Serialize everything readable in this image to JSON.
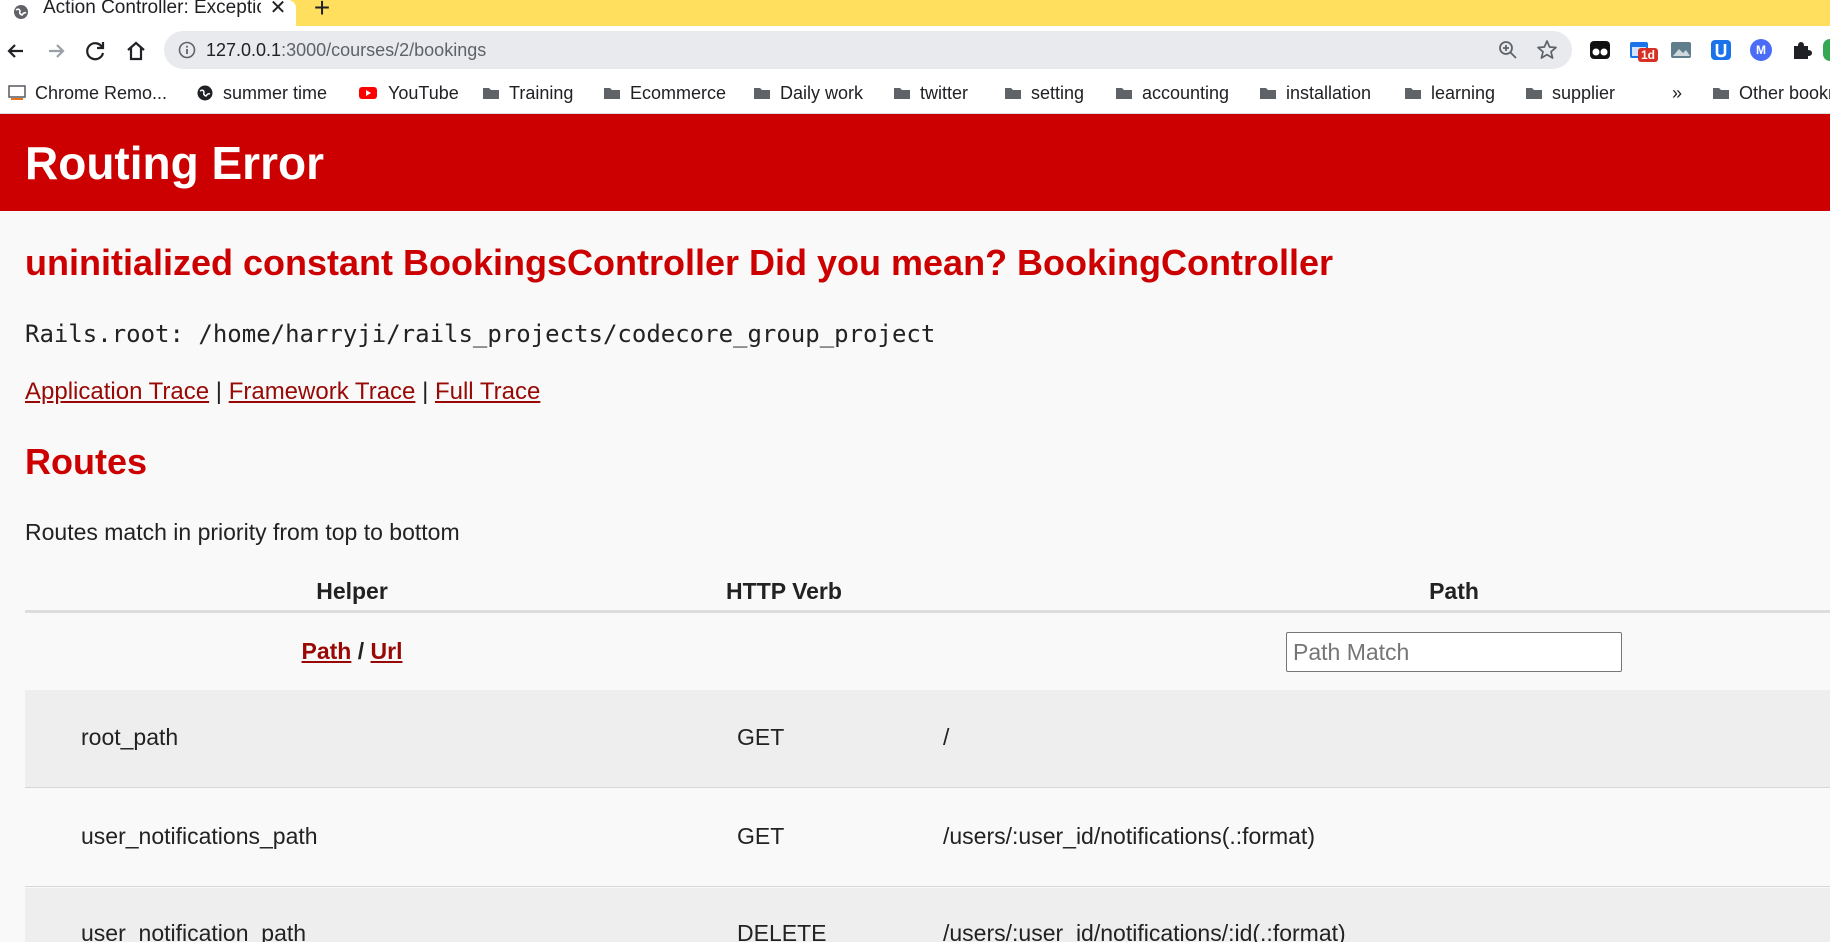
{
  "browser": {
    "tab": {
      "title": "Action Controller: Exception caught"
    },
    "address": {
      "host": "127.0.0.1",
      "rest": ":3000/courses/2/bookings"
    },
    "bookmarks": [
      {
        "label": "Chrome Remo...",
        "icon": "remote-desktop-icon"
      },
      {
        "label": "summer time",
        "icon": "globe-icon"
      },
      {
        "label": "YouTube",
        "icon": "youtube-icon"
      },
      {
        "label": "Training",
        "icon": "folder-icon"
      },
      {
        "label": "Ecommerce",
        "icon": "folder-icon"
      },
      {
        "label": "Daily work",
        "icon": "folder-icon"
      },
      {
        "label": "twitter",
        "icon": "folder-icon"
      },
      {
        "label": "setting",
        "icon": "folder-icon"
      },
      {
        "label": "accounting",
        "icon": "folder-icon"
      },
      {
        "label": "installation",
        "icon": "folder-icon"
      },
      {
        "label": "learning",
        "icon": "folder-icon"
      },
      {
        "label": "supplier",
        "icon": "folder-icon"
      }
    ],
    "bookmarks_overflow": "»",
    "other_bookmarks": "Other bookmarks",
    "extension_badge": "1d",
    "extension_avatar_letter": "M"
  },
  "page": {
    "header": "Routing Error",
    "error_message": "uninitialized constant BookingsController Did you mean?  BookingController",
    "rails_root": "Rails.root: /home/harryji/rails_projects/codecore_group_project",
    "traces": {
      "application": "Application Trace",
      "framework": "Framework Trace",
      "full": "Full Trace",
      "separator": "|"
    },
    "routes_title": "Routes",
    "routes_description": "Routes match in priority from top to bottom",
    "table": {
      "headers": {
        "helper": "Helper",
        "verb": "HTTP Verb",
        "path": "Path"
      },
      "helper_toggle": {
        "path": "Path",
        "separator": "/",
        "url": "Url"
      },
      "path_match_placeholder": "Path Match",
      "rows": [
        {
          "helper": "root_path",
          "verb": "GET",
          "path": "/"
        },
        {
          "helper": "user_notifications_path",
          "verb": "GET",
          "path": "/users/:user_id/notifications(.:format)"
        },
        {
          "helper": "user_notification_path",
          "verb": "DELETE",
          "path": "/users/:user_id/notifications/:id(.:format)"
        }
      ]
    }
  },
  "colors": {
    "tabstrip": "#ffdf5d",
    "header_bg": "#cc0000",
    "link": "#980905",
    "row_odd": "#eeeeee"
  }
}
